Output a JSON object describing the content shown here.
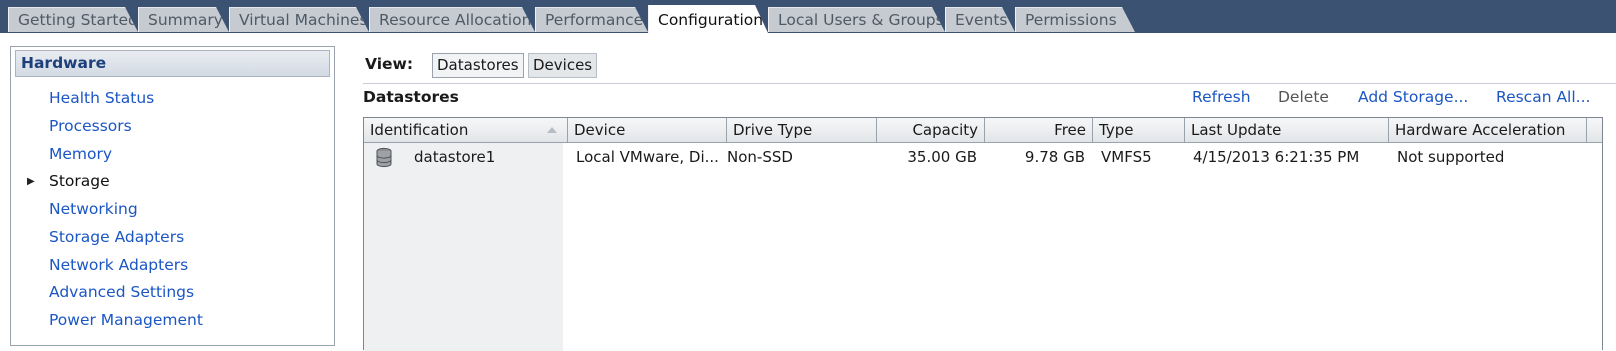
{
  "tabs": [
    {
      "label": "Getting Started",
      "active": false
    },
    {
      "label": "Summary",
      "active": false
    },
    {
      "label": "Virtual Machines",
      "active": false
    },
    {
      "label": "Resource Allocation",
      "active": false
    },
    {
      "label": "Performance",
      "active": false
    },
    {
      "label": "Configuration",
      "active": true
    },
    {
      "label": "Local Users & Groups",
      "active": false
    },
    {
      "label": "Events",
      "active": false
    },
    {
      "label": "Permissions",
      "active": false
    }
  ],
  "hardware": {
    "title": "Hardware",
    "items": [
      {
        "label": "Health Status"
      },
      {
        "label": "Processors"
      },
      {
        "label": "Memory"
      },
      {
        "label": "Storage",
        "current": true
      },
      {
        "label": "Networking"
      },
      {
        "label": "Storage Adapters"
      },
      {
        "label": "Network Adapters"
      },
      {
        "label": "Advanced Settings"
      },
      {
        "label": "Power Management"
      }
    ]
  },
  "view": {
    "label": "View:",
    "options": [
      "Datastores",
      "Devices"
    ],
    "selected": "Datastores"
  },
  "datastores": {
    "title": "Datastores",
    "actions": {
      "refresh": "Refresh",
      "delete": "Delete",
      "add_storage": "Add Storage...",
      "rescan_all": "Rescan All..."
    },
    "columns": [
      "Identification",
      "Device",
      "Drive Type",
      "Capacity",
      "Free",
      "Type",
      "Last Update",
      "Hardware Acceleration"
    ],
    "rows": [
      {
        "icon": "database-icon",
        "identification": "datastore1",
        "device": "Local VMware, Di...",
        "drive_type": "Non-SSD",
        "capacity": "35.00 GB",
        "free": "9.78 GB",
        "type": "VMFS5",
        "last_update": "4/15/2013 6:21:35 PM",
        "hardware_acceleration": "Not supported"
      }
    ]
  },
  "colors": {
    "tabbar_bg": "#3c5272",
    "link": "#1b56c4",
    "header_text": "#1d3f7a"
  }
}
